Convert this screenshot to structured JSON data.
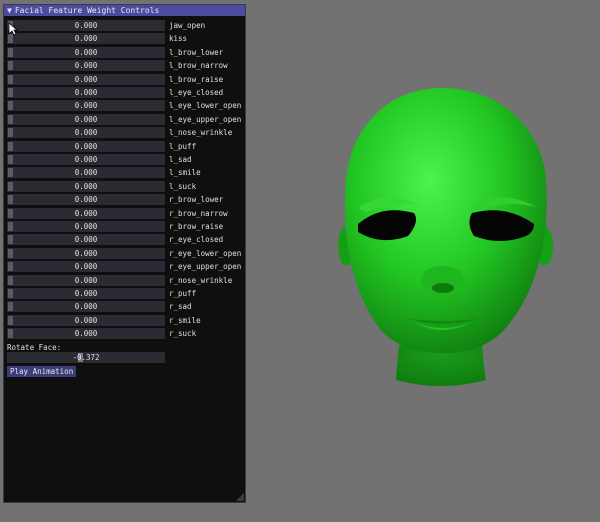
{
  "window": {
    "title": "Facial Feature Weight Controls",
    "collapse_glyph": "▼"
  },
  "weights": [
    {
      "name": "jaw_open",
      "value": "0.000"
    },
    {
      "name": "kiss",
      "value": "0.000"
    },
    {
      "name": "l_brow_lower",
      "value": "0.000"
    },
    {
      "name": "l_brow_narrow",
      "value": "0.000"
    },
    {
      "name": "l_brow_raise",
      "value": "0.000"
    },
    {
      "name": "l_eye_closed",
      "value": "0.000"
    },
    {
      "name": "l_eye_lower_open",
      "value": "0.000"
    },
    {
      "name": "l_eye_upper_open",
      "value": "0.000"
    },
    {
      "name": "l_nose_wrinkle",
      "value": "0.000"
    },
    {
      "name": "l_puff",
      "value": "0.000"
    },
    {
      "name": "l_sad",
      "value": "0.000"
    },
    {
      "name": "l_smile",
      "value": "0.000"
    },
    {
      "name": "l_suck",
      "value": "0.000"
    },
    {
      "name": "r_brow_lower",
      "value": "0.000"
    },
    {
      "name": "r_brow_narrow",
      "value": "0.000"
    },
    {
      "name": "r_brow_raise",
      "value": "0.000"
    },
    {
      "name": "r_eye_closed",
      "value": "0.000"
    },
    {
      "name": "r_eye_lower_open",
      "value": "0.000"
    },
    {
      "name": "r_eye_upper_open",
      "value": "0.000"
    },
    {
      "name": "r_nose_wrinkle",
      "value": "0.000"
    },
    {
      "name": "r_puff",
      "value": "0.000"
    },
    {
      "name": "r_sad",
      "value": "0.000"
    },
    {
      "name": "r_smile",
      "value": "0.000"
    },
    {
      "name": "r_suck",
      "value": "0.000"
    }
  ],
  "rotate": {
    "label": "Rotate Face:",
    "value": "-0.372",
    "position_fraction": 0.47
  },
  "play_button": {
    "label": "Play Animation"
  },
  "colors": {
    "viewport_bg": "#727272",
    "face": "#22c622",
    "panel_bg": "#0f0f10",
    "title_bg": "#4b4ba0",
    "button_bg": "#3c3c78"
  },
  "icons": {
    "cursor": "mouse-pointer-icon",
    "resize": "resize-grip-icon"
  }
}
